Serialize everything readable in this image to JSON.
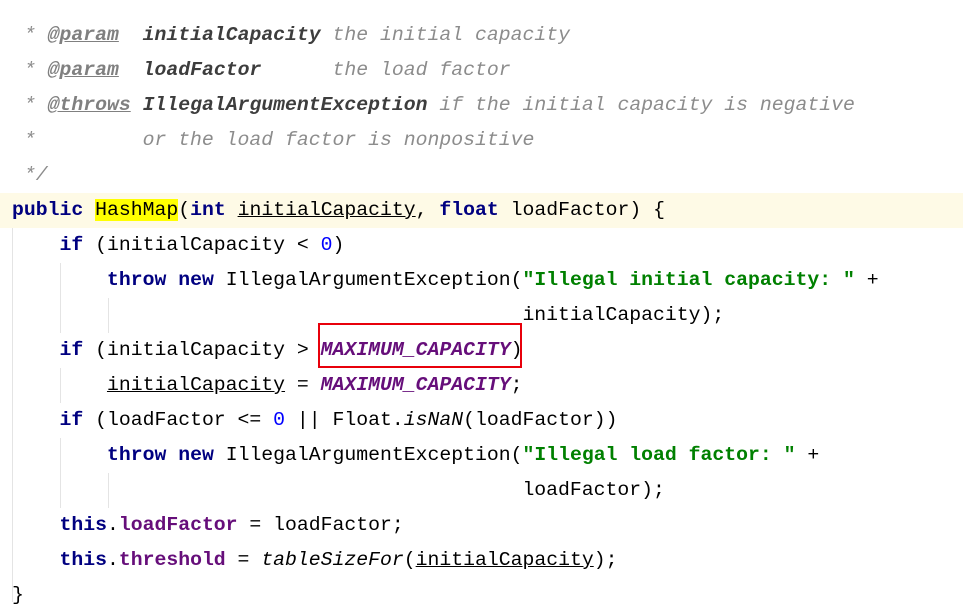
{
  "colors": {
    "keyword": "#000080",
    "comment": "#8c8c8c",
    "string": "#008000",
    "number": "#0000ff",
    "constant": "#660e7a",
    "highlight": "#ffff00",
    "current_line": "#fefae6",
    "annotation_box": "#e8000b"
  },
  "annotation": {
    "target": "MAXIMUM_CAPACITY"
  },
  "lines": [
    [
      [
        " *",
        "cm"
      ]
    ],
    [
      [
        " * ",
        "cm"
      ],
      [
        "@param",
        "tag"
      ],
      [
        "  ",
        "cm"
      ],
      [
        "initialCapacity",
        "dn"
      ],
      [
        " the initial capacity",
        "cm"
      ]
    ],
    [
      [
        " * ",
        "cm"
      ],
      [
        "@param",
        "tag"
      ],
      [
        "  ",
        "cm"
      ],
      [
        "loadFactor",
        "dn"
      ],
      [
        "      the load factor",
        "cm"
      ]
    ],
    [
      [
        " * ",
        "cm"
      ],
      [
        "@throws",
        "tag"
      ],
      [
        " ",
        "cm"
      ],
      [
        "IllegalArgumentException",
        "dn"
      ],
      [
        " if the initial capacity is negative",
        "cm"
      ]
    ],
    [
      [
        " *         or the load factor is nonpositive",
        "cm"
      ]
    ],
    [
      [
        " */",
        "cm"
      ]
    ],
    [
      [
        "public",
        "kw"
      ],
      [
        " ",
        ""
      ],
      [
        "HashMap",
        "hl"
      ],
      [
        "(",
        ""
      ],
      [
        "int",
        "kw"
      ],
      [
        " ",
        ""
      ],
      [
        "initialCapacity",
        "ul"
      ],
      [
        ", ",
        ""
      ],
      [
        "float",
        "kw"
      ],
      [
        " loadFactor) {",
        ""
      ]
    ],
    [
      [
        "    ",
        ""
      ],
      [
        "if",
        "kw"
      ],
      [
        " (initialCapacity < ",
        ""
      ],
      [
        "0",
        "num"
      ],
      [
        ")",
        ""
      ]
    ],
    [
      [
        "        ",
        ""
      ],
      [
        "throw",
        "kw"
      ],
      [
        " ",
        ""
      ],
      [
        "new",
        "kw"
      ],
      [
        " IllegalArgumentException(",
        ""
      ],
      [
        "\"Illegal initial capacity: \"",
        "str"
      ],
      [
        " +",
        ""
      ]
    ],
    [
      [
        "                                           initialCapacity);",
        ""
      ]
    ],
    [
      [
        "    ",
        ""
      ],
      [
        "if",
        "kw"
      ],
      [
        " (initialCapacity > ",
        ""
      ],
      [
        "MAXIMUM_CAPACITY",
        "const"
      ],
      [
        ")",
        ""
      ]
    ],
    [
      [
        "        ",
        ""
      ],
      [
        "initialCapacity",
        "ul"
      ],
      [
        " = ",
        ""
      ],
      [
        "MAXIMUM_CAPACITY",
        "const"
      ],
      [
        ";",
        ""
      ]
    ],
    [
      [
        "    ",
        ""
      ],
      [
        "if",
        "kw"
      ],
      [
        " (loadFactor <= ",
        ""
      ],
      [
        "0",
        "num"
      ],
      [
        " || Float.",
        ""
      ],
      [
        "isNaN",
        "sm"
      ],
      [
        "(loadFactor))",
        ""
      ]
    ],
    [
      [
        "        ",
        ""
      ],
      [
        "throw",
        "kw"
      ],
      [
        " ",
        ""
      ],
      [
        "new",
        "kw"
      ],
      [
        " IllegalArgumentException(",
        ""
      ],
      [
        "\"Illegal load factor: \"",
        "str"
      ],
      [
        " +",
        ""
      ]
    ],
    [
      [
        "                                           loadFactor);",
        ""
      ]
    ],
    [
      [
        "    ",
        ""
      ],
      [
        "this",
        "kw"
      ],
      [
        ".",
        ""
      ],
      [
        "loadFactor",
        "field"
      ],
      [
        " = loadFactor;",
        ""
      ]
    ],
    [
      [
        "    ",
        ""
      ],
      [
        "this",
        "kw"
      ],
      [
        ".",
        ""
      ],
      [
        "threshold",
        "field"
      ],
      [
        " = ",
        ""
      ],
      [
        "tableSizeFor",
        "sm"
      ],
      [
        "(",
        ""
      ],
      [
        "initialCapacity",
        "ul"
      ],
      [
        ");",
        ""
      ]
    ],
    [
      [
        "}",
        ""
      ]
    ]
  ]
}
